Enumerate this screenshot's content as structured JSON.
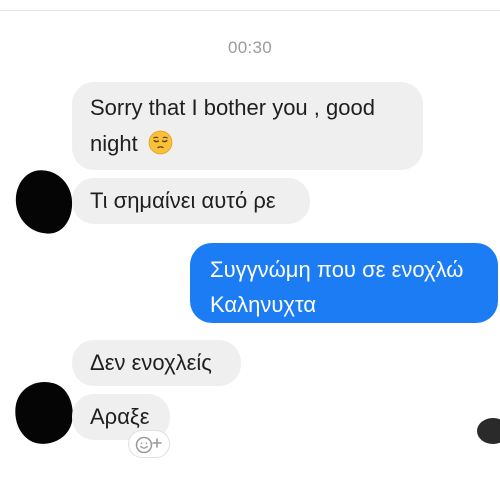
{
  "conversation": {
    "timestamp": "00:30",
    "messages": [
      {
        "id": "msg-1",
        "direction": "incoming",
        "text": "Sorry that I  bother you , good night",
        "emoji": "pensive-face-icon"
      },
      {
        "id": "msg-2",
        "direction": "incoming",
        "text": "Τι σημαίνει αυτό ρε"
      },
      {
        "id": "msg-3",
        "direction": "outgoing",
        "line1": "Συγγνώμη που σε ενοχλώ",
        "line2": "Καληνυχτα"
      },
      {
        "id": "msg-4",
        "direction": "incoming",
        "text": "Δεν ενοχλείς"
      },
      {
        "id": "msg-5",
        "direction": "incoming",
        "text": "Αραξε"
      }
    ],
    "reaction_button": {
      "icon": "add-reaction-icon",
      "glyph": "+"
    }
  },
  "colors": {
    "incoming_bubble": "#efefef",
    "outgoing_bubble": "#1c7cf4",
    "incoming_text": "#1f1f1f",
    "outgoing_text": "#ffffff",
    "timestamp_text": "#9b9b9b",
    "redaction": "#050505"
  }
}
